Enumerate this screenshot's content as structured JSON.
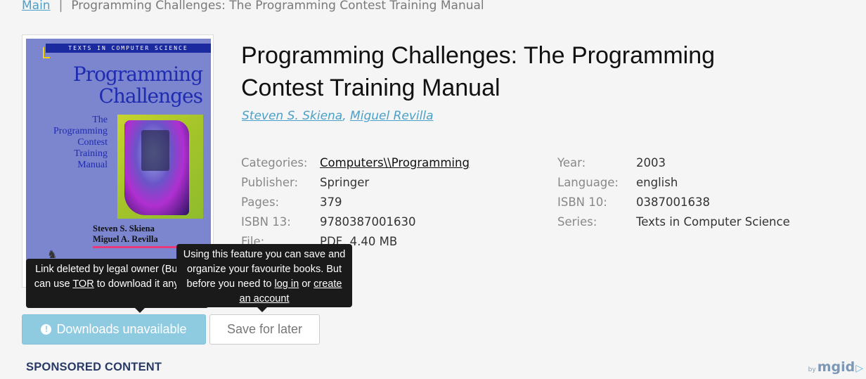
{
  "breadcrumb": {
    "home": "Main",
    "separator": "|",
    "current": "Programming Challenges: The Programming Contest Training Manual"
  },
  "cover": {
    "series": "TEXTS IN COMPUTER SCIENCE",
    "title_line1": "Programming",
    "title_line2": "Challenges",
    "sub_line1": "The",
    "sub_line2": "Programming",
    "sub_line3": "Contest",
    "sub_line4": "Training",
    "sub_line5": "Manual",
    "author1": "Steven S. Skiena",
    "author2": "Miguel A. Revilla"
  },
  "book": {
    "title": "Programming Challenges: The Programming Contest Training Manual",
    "authors": [
      "Steven S. Skiena",
      "Miguel Revilla"
    ],
    "author_sep": ", "
  },
  "details_left": [
    {
      "label": "Categories:",
      "value": "Computers\\\\Programming"
    },
    {
      "label": "Publisher:",
      "value": "Springer"
    },
    {
      "label": "Pages:",
      "value": "379"
    },
    {
      "label": "ISBN 13:",
      "value": "9780387001630"
    },
    {
      "label": "File:",
      "value": "PDF, 4.40 MB"
    }
  ],
  "details_right": [
    {
      "label": "Year:",
      "value": "2003"
    },
    {
      "label": "Language:",
      "value": "english"
    },
    {
      "label": "ISBN 10:",
      "value": "0387001638"
    },
    {
      "label": "Series:",
      "value": "Texts in Computer Science"
    }
  ],
  "tooltip_download": {
    "text_before": "Link deleted by legal owner (But you can use ",
    "link": "TOR",
    "text_after": " to download it anyway)"
  },
  "tooltip_save": {
    "text_before": "Using this feature you can save and organize your favourite books. But before you need to ",
    "link1": "log in",
    "middle": " or ",
    "link2": "create an account"
  },
  "buttons": {
    "download": "Downloads unavailable",
    "download_icon": "exclamation-circle-icon",
    "save": "Save for later"
  },
  "sponsored": "SPONSORED CONTENT",
  "mgid": {
    "by": "by",
    "brand": "mgid"
  },
  "colors": {
    "link": "#4aa0c8",
    "download_button": "#8ecbe1",
    "tooltip_bg": "#1a1a1a",
    "sponsored": "#2a3a66"
  }
}
